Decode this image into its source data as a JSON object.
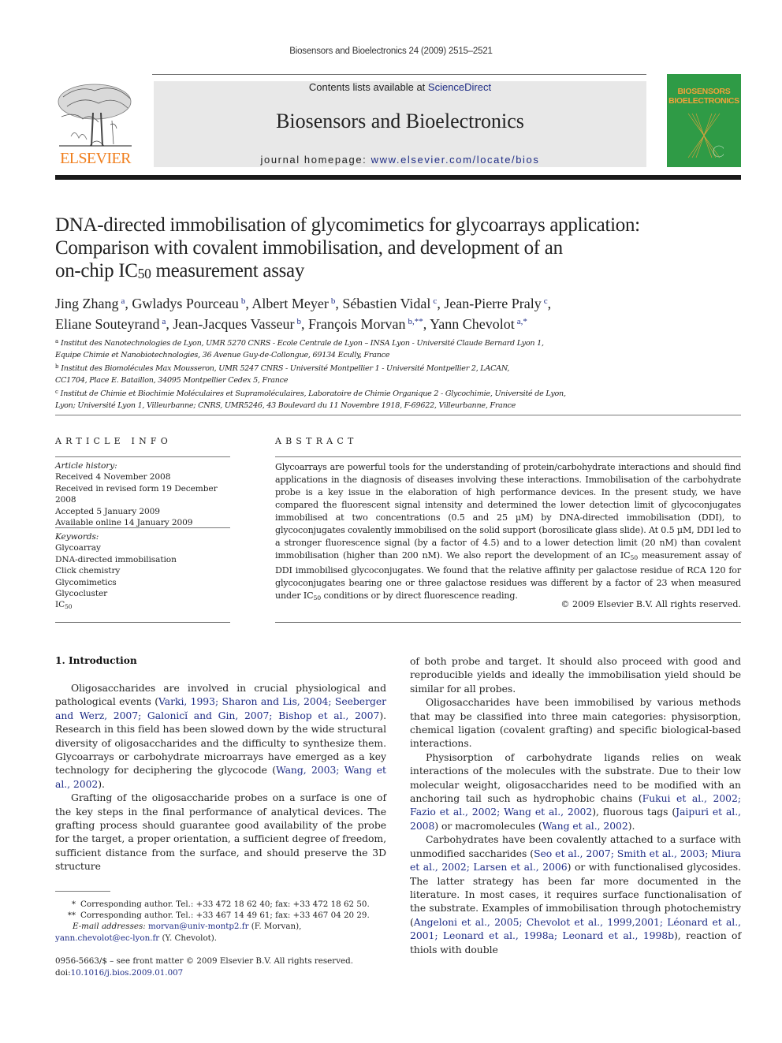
{
  "running_head": "Biosensors and Bioelectronics 24 (2009) 2515–2521",
  "header": {
    "publisher_logo_text": "ELSEVIER",
    "contents_prefix": "Contents lists available at ",
    "contents_link": "ScienceDirect",
    "journal_title": "Biosensors and Bioelectronics",
    "homepage_prefix": "journal homepage: ",
    "homepage_link": "www.elsevier.com/locate/bios",
    "cover_title_line1": "BIOSENSORS",
    "cover_title_line2": "BIOELECTRONICS",
    "colors": {
      "brand_orange": "#f07f1e",
      "cover_green": "#2f9b46",
      "link_blue": "#1f2d86",
      "banner_gray": "#e8e8e8"
    }
  },
  "article": {
    "title_line1": "DNA-directed immobilisation of glycomimetics for glycoarrays application:",
    "title_line2": "Comparison with covalent immobilisation, and development of an",
    "title_line3_pre": "on-chip IC",
    "title_line3_sub": "50",
    "title_line3_post": " measurement assay",
    "authors": [
      {
        "name": "Jing Zhang",
        "sup": "a",
        "sep": ", "
      },
      {
        "name": "Gwladys Pourceau",
        "sup": "b",
        "sep": ", "
      },
      {
        "name": "Albert Meyer",
        "sup": "b",
        "sep": ", "
      },
      {
        "name": "Sébastien Vidal",
        "sup": "c",
        "sep": ", "
      },
      {
        "name": "Jean-Pierre Praly",
        "sup": "c",
        "sep": ","
      },
      {
        "name": "Eliane Souteyrand",
        "sup": "a",
        "sep": ", "
      },
      {
        "name": "Jean-Jacques Vasseur",
        "sup": "b",
        "sep": ", "
      },
      {
        "name": "François Morvan",
        "sup": "b,**",
        "sep": ", "
      },
      {
        "name": "Yann Chevolot",
        "sup": "a,*",
        "sep": ""
      }
    ],
    "affiliations": [
      {
        "sup": "a",
        "text": "Institut des Nanotechnologies de Lyon, UMR 5270 CNRS - Ecole Centrale de Lyon – INSA Lyon - Université Claude Bernard Lyon 1,"
      },
      {
        "sup": "",
        "text": "Equipe Chimie et Nanobiotechnologies, 36 Avenue Guy-de-Collongue, 69134 Ecully, France"
      },
      {
        "sup": "b",
        "text": "Institut des Biomolécules Max Mousseron, UMR 5247 CNRS - Université Montpellier 1 - Université Montpellier 2, LACAN,"
      },
      {
        "sup": "",
        "text": "CC1704, Place E. Bataillon, 34095 Montpellier Cedex 5, France"
      },
      {
        "sup": "c",
        "text": "Institut de Chimie et Biochimie Moléculaires et Supramoléculaires, Laboratoire de Chimie Organique 2 - Glycochimie, Université de Lyon,"
      },
      {
        "sup": "",
        "text": "Lyon; Université Lyon 1, Villeurbanne; CNRS, UMR5246, 43 Boulevard du 11 Novembre 1918, F-69622, Villeurbanne, France"
      }
    ]
  },
  "article_info": {
    "heading": "ARTICLE INFO",
    "history_label": "Article history:",
    "history": [
      "Received 4 November 2008",
      "Received in revised form 19 December 2008",
      "Accepted 5 January 2009",
      "Available online 14 January 2009"
    ],
    "keywords_label": "Keywords:",
    "keywords": [
      "Glycoarray",
      "DNA-directed immobilisation",
      "Click chemistry",
      "Glycomimetics",
      "Glycocluster"
    ],
    "keyword_last_pre": "IC",
    "keyword_last_sub": "50"
  },
  "abstract": {
    "heading": "ABSTRACT",
    "part1": "Glycoarrays are powerful tools for the understanding of protein/carbohydrate interactions and should find applications in the diagnosis of diseases involving these interactions. Immobilisation of the carbohydrate probe is a key issue in the elaboration of high performance devices. In the present study, we have compared the fluorescent signal intensity and determined the lower detection limit of glycoconjugates immobilised at two concentrations (0.5 and 25 µM) by DNA-directed immobilisation (DDI), to glycoconjugates covalently immobilised on the solid support (borosilicate glass slide). At 0.5 µM, DDI led to a stronger fluorescence signal (by a factor of 4.5) and to a lower detection limit (20 nM) than covalent immobilisation (higher than 200 nM). We also report the development of an IC",
    "sub1": "50",
    "part2": " measurement assay of DDI immobilised glycoconjugates. We found that the relative affinity per galactose residue of RCA 120 for glycoconjugates bearing one or three galactose residues was different by a factor of 23 when measured under IC",
    "sub2": "50",
    "part3": " conditions or by direct fluorescence reading.",
    "copyright": "© 2009 Elsevier B.V. All rights reserved."
  },
  "introduction": {
    "heading": "1.  Introduction",
    "left_col": {
      "p1_a": "Oligosaccharides are involved in crucial physiological and pathological events (",
      "p1_ref1": "Varki, 1993; Sharon and Lis, 2004; Seeberger and Werz, 2007; Galonicĭ and Gin, 2007; Bishop et al., 2007",
      "p1_b": "). Research in this field has been slowed down by the wide structural diversity of oligosaccharides and the difficulty to synthesize them. Glycoarrays or carbohydrate microarrays have emerged as a key technology for deciphering the glycocode (",
      "p1_ref2": "Wang, 2003; Wang et al., 2002",
      "p1_c": ").",
      "p2": "Grafting of the oligosaccharide probes on a surface is one of the key steps in the final performance of analytical devices. The grafting process should guarantee good availability of the probe for the target, a proper orientation, a sufficient degree of freedom, sufficient distance from the surface, and should preserve the 3D structure"
    },
    "right_col": {
      "p0": "of both probe and target. It should also proceed with good and reproducible yields and ideally the immobilisation yield should be similar for all probes.",
      "p1": "Oligosaccharides have been immobilised by various methods that may be classified into three main categories: physisorption, chemical ligation (covalent grafting) and specific biological-based interactions.",
      "p2_a": "Physisorption of carbohydrate ligands relies on weak interactions of the molecules with the substrate. Due to their low molecular weight, oligosaccharides need to be modified with an anchoring tail such as hydrophobic chains (",
      "p2_ref1": "Fukui et al., 2002; Fazio et al., 2002; Wang et al., 2002",
      "p2_b": "), fluorous tags (",
      "p2_ref2": "Jaipuri et al., 2008",
      "p2_c": ") or macromolecules (",
      "p2_ref3": "Wang et al., 2002",
      "p2_d": ").",
      "p3_a": "Carbohydrates have been covalently attached to a surface with unmodified saccharides (",
      "p3_ref1": "Seo et al., 2007; Smith et al., 2003; Miura et al., 2002; Larsen et al., 2006",
      "p3_b": ") or with functionalised glycosides. The latter strategy has been far more documented in the literature. In most cases, it requires surface functionalisation of the substrate. Examples of immobilisation through photochemistry (",
      "p3_ref2": "Angeloni et al., 2005; Chevolot et al., 1999,2001; Léonard et al., 2001; Leonard et al., 1998a; Leonard et al., 1998b",
      "p3_c": "), reaction of thiols with double"
    }
  },
  "footnotes": {
    "fn1_mark": "*",
    "fn1": "Corresponding author. Tel.: +33 472 18 62 40; fax: +33 472 18 62 50.",
    "fn2_mark": "**",
    "fn2": "Corresponding author. Tel.: +33 467 14 49 61; fax: +33 467 04 20 29.",
    "email_label": "E-mail addresses:",
    "email1": "morvan@univ-montp2.fr",
    "email1_owner": " (F. Morvan),",
    "email2": "yann.chevolot@ec-lyon.fr",
    "email2_owner": " (Y. Chevolot).",
    "front_matter": "0956-5663/$ – see front matter © 2009 Elsevier B.V. All rights reserved.",
    "doi_label": "doi:",
    "doi": "10.1016/j.bios.2009.01.007"
  }
}
